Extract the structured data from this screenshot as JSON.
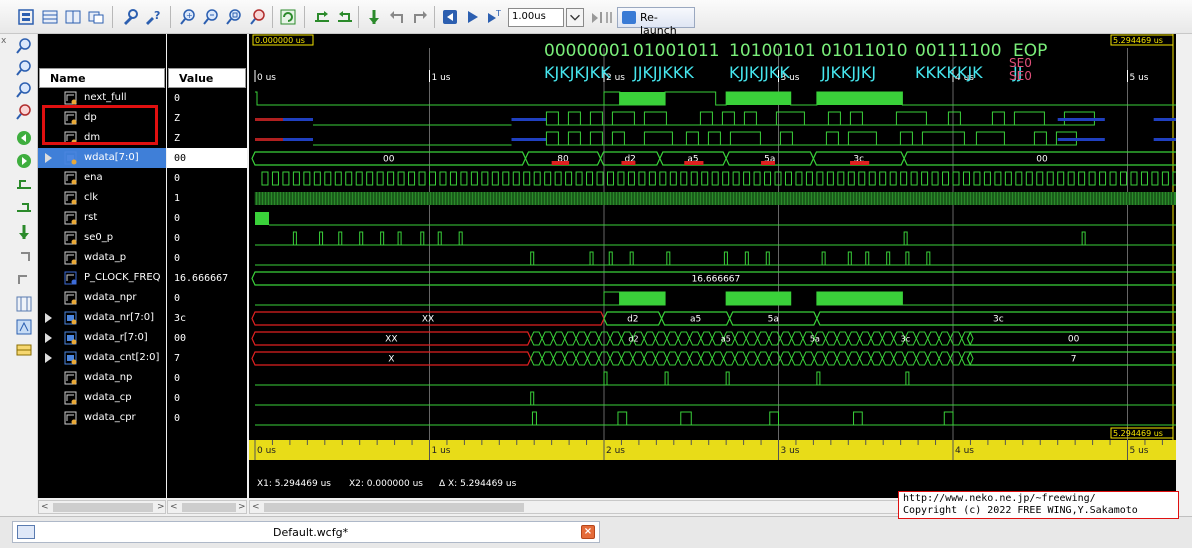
{
  "toolbar": {
    "zoom_value": "1.00us",
    "relaunch_label": "Re-launch",
    "icons": [
      "select-all-icon",
      "collapse-icon",
      "expand-icon",
      "restore-icon",
      "settings-icon",
      "help-icon",
      "zoom-in-icon",
      "zoom-out-icon",
      "zoom-fit-icon",
      "zoom-cursor-icon",
      "refresh-icon",
      "go-start-icon",
      "go-end-icon",
      "add-marker-icon",
      "prev-marker-icon",
      "next-marker-icon",
      "restart-icon",
      "run-icon",
      "run-for-icon",
      "step-icon",
      "pause-icon"
    ]
  },
  "columns": {
    "name": "Name",
    "value": "Value"
  },
  "signals": [
    {
      "name": "next_full",
      "value": "0",
      "bus": false,
      "type": "wire"
    },
    {
      "name": "dp",
      "value": "Z",
      "bus": false,
      "type": "wire"
    },
    {
      "name": "dm",
      "value": "Z",
      "bus": false,
      "type": "wire"
    },
    {
      "name": "wdata[7:0]",
      "value": "00",
      "bus": true,
      "type": "bus",
      "selected": true
    },
    {
      "name": "ena",
      "value": "0",
      "bus": false,
      "type": "wire"
    },
    {
      "name": "clk",
      "value": "1",
      "bus": false,
      "type": "wire"
    },
    {
      "name": "rst",
      "value": "0",
      "bus": false,
      "type": "wire"
    },
    {
      "name": "se0_p",
      "value": "0",
      "bus": false,
      "type": "wire"
    },
    {
      "name": "wdata_p",
      "value": "0",
      "bus": false,
      "type": "wire"
    },
    {
      "name": "P_CLOCK_FREQ",
      "value": "16.666667",
      "bus": false,
      "type": "param"
    },
    {
      "name": "wdata_npr",
      "value": "0",
      "bus": false,
      "type": "wire"
    },
    {
      "name": "wdata_nr[7:0]",
      "value": "3c",
      "bus": true,
      "type": "bus"
    },
    {
      "name": "wdata_r[7:0]",
      "value": "00",
      "bus": true,
      "type": "bus"
    },
    {
      "name": "wdata_cnt[2:0]",
      "value": "7",
      "bus": true,
      "type": "bus"
    },
    {
      "name": "wdata_np",
      "value": "0",
      "bus": false,
      "type": "wire"
    },
    {
      "name": "wdata_cp",
      "value": "0",
      "bus": false,
      "type": "wire"
    },
    {
      "name": "wdata_cpr",
      "value": "0",
      "bus": false,
      "type": "wire"
    }
  ],
  "wave": {
    "cursor_time_left": "0.000000 us",
    "cursor_time_right": "5.294469 us",
    "time_ticks": [
      "0 us",
      "1 us",
      "2 us",
      "3 us",
      "4 us",
      "5 us"
    ],
    "annotations": {
      "bits": [
        "00000001",
        "01001011",
        "10100101",
        "01011010",
        "00111100",
        "EOP"
      ],
      "symbols": [
        "KJKJKJKK",
        "JJKJJKKK",
        "KJJKJJKK",
        "JJKKJJKJ",
        "KKKKKJK",
        "JJ"
      ],
      "se0": [
        "SE0",
        "SE0"
      ],
      "se0_color": "#e0507a",
      "bits_color": "#7aee7a",
      "symbols_color": "#46e6ee"
    },
    "bus_labels": {
      "wdata": [
        "00",
        "80",
        "d2",
        "a5",
        "5a",
        "3c",
        "00"
      ],
      "p_clock_freq": "16.666667",
      "wdata_nr": [
        "XX",
        "d2",
        "a5",
        "5a",
        "3c"
      ],
      "wdata_r": [
        "XX",
        "d2",
        "a5",
        "5a",
        "3c",
        "00"
      ],
      "wdata_cnt": [
        "X",
        "7"
      ]
    }
  },
  "status": {
    "x1": "X1: 5.294469 us",
    "x2": "X2: 0.000000 us",
    "delta": "Δ X: 5.294469 us"
  },
  "tab": {
    "label": "Default.wcfg*"
  },
  "copyright": {
    "line1": "http://www.neko.ne.jp/~freewing/",
    "line2": "Copyright (c) 2022 FREE WING,Y.Sakamoto"
  }
}
